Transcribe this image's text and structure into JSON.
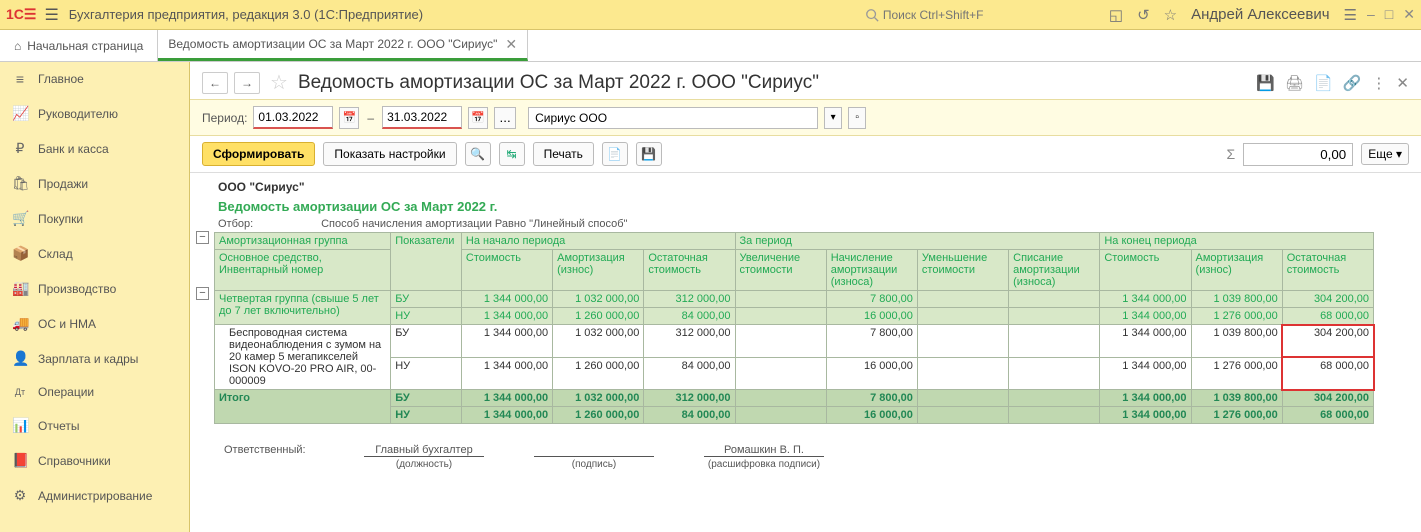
{
  "header": {
    "app_title": "Бухгалтерия предприятия, редакция 3.0  (1С:Предприятие)",
    "search_placeholder": "Поиск Ctrl+Shift+F",
    "user_name": "Андрей Алексеевич"
  },
  "tabs": {
    "home": "Начальная страница",
    "doc": "Ведомость амортизации ОС за Март 2022 г. ООО \"Сириус\""
  },
  "sidebar": {
    "items": [
      {
        "icon": "≡",
        "label": "Главное"
      },
      {
        "icon": "📈",
        "label": "Руководителю"
      },
      {
        "icon": "₽",
        "label": "Банк и касса"
      },
      {
        "icon": "🛍",
        "label": "Продажи"
      },
      {
        "icon": "🛒",
        "label": "Покупки"
      },
      {
        "icon": "📦",
        "label": "Склад"
      },
      {
        "icon": "🏭",
        "label": "Производство"
      },
      {
        "icon": "🚚",
        "label": "ОС и НМА"
      },
      {
        "icon": "👤",
        "label": "Зарплата и кадры"
      },
      {
        "icon": "Дт",
        "label": "Операции"
      },
      {
        "icon": "📊",
        "label": "Отчеты"
      },
      {
        "icon": "📕",
        "label": "Справочники"
      },
      {
        "icon": "⚙",
        "label": "Администрирование"
      }
    ]
  },
  "page": {
    "title": "Ведомость амортизации ОС за Март 2022 г. ООО \"Сириус\""
  },
  "filter": {
    "period_label": "Период:",
    "date_from": "01.03.2022",
    "date_to": "31.03.2022",
    "company": "Сириус ООО"
  },
  "actions": {
    "generate": "Сформировать",
    "show_settings": "Показать настройки",
    "print": "Печать",
    "sum_value": "0,00",
    "more": "Еще"
  },
  "report": {
    "org": "ООО \"Сириус\"",
    "title": "Ведомость амортизации ОС за Март 2022 г.",
    "filter_label": "Отбор:",
    "filter_text": "Способ начисления амортизации Равно \"Линейный способ\"",
    "headers": {
      "amort_group": "Амортизационная группа",
      "asset": "Основное средство, Инвентарный номер",
      "indicators": "Показатели",
      "period_start": "На начало периода",
      "period": "За период",
      "period_end": "На конец периода",
      "cost": "Стоимость",
      "depr": "Амортизация (износ)",
      "residual": "Остаточная стоимость",
      "cost_inc": "Увеличение стоимости",
      "depr_acc": "Начисление амортизации (износа)",
      "cost_dec": "Уменьшение стоимости",
      "depr_write": "Списание амортизации (износа)"
    },
    "group_name": "Четвертая группа (свыше 5 лет до 7 лет включительно)",
    "asset_name": "Беспроводная система видеонаблюдения с зумом на 20 камер 5 мегапикселей ISON KOVO-20 PRO AIR, 00-000009",
    "bu": "БУ",
    "nu": "НУ",
    "totals": "Итого",
    "row_group_bu": {
      "cost_s": "1 344 000,00",
      "depr_s": "1 032 000,00",
      "res_s": "312 000,00",
      "inc": "",
      "acc": "7 800,00",
      "dec": "",
      "wr": "",
      "cost_e": "1 344 000,00",
      "depr_e": "1 039 800,00",
      "res_e": "304 200,00"
    },
    "row_group_nu": {
      "cost_s": "1 344 000,00",
      "depr_s": "1 260 000,00",
      "res_s": "84 000,00",
      "inc": "",
      "acc": "16 000,00",
      "dec": "",
      "wr": "",
      "cost_e": "1 344 000,00",
      "depr_e": "1 276 000,00",
      "res_e": "68 000,00"
    },
    "row_asset_bu": {
      "cost_s": "1 344 000,00",
      "depr_s": "1 032 000,00",
      "res_s": "312 000,00",
      "inc": "",
      "acc": "7 800,00",
      "dec": "",
      "wr": "",
      "cost_e": "1 344 000,00",
      "depr_e": "1 039 800,00",
      "res_e": "304 200,00"
    },
    "row_asset_nu": {
      "cost_s": "1 344 000,00",
      "depr_s": "1 260 000,00",
      "res_s": "84 000,00",
      "inc": "",
      "acc": "16 000,00",
      "dec": "",
      "wr": "",
      "cost_e": "1 344 000,00",
      "depr_e": "1 276 000,00",
      "res_e": "68 000,00"
    },
    "row_total_bu": {
      "cost_s": "1 344 000,00",
      "depr_s": "1 032 000,00",
      "res_s": "312 000,00",
      "inc": "",
      "acc": "7 800,00",
      "dec": "",
      "wr": "",
      "cost_e": "1 344 000,00",
      "depr_e": "1 039 800,00",
      "res_e": "304 200,00"
    },
    "row_total_nu": {
      "cost_s": "1 344 000,00",
      "depr_s": "1 260 000,00",
      "res_s": "84 000,00",
      "inc": "",
      "acc": "16 000,00",
      "dec": "",
      "wr": "",
      "cost_e": "1 344 000,00",
      "depr_e": "1 276 000,00",
      "res_e": "68 000,00"
    },
    "sig": {
      "responsible": "Ответственный:",
      "chief_acc": "Главный бухгалтер",
      "position": "(должность)",
      "signature": "(подпись)",
      "name": "Ромашкин В. П.",
      "decoded": "(расшифровка подписи)"
    }
  }
}
